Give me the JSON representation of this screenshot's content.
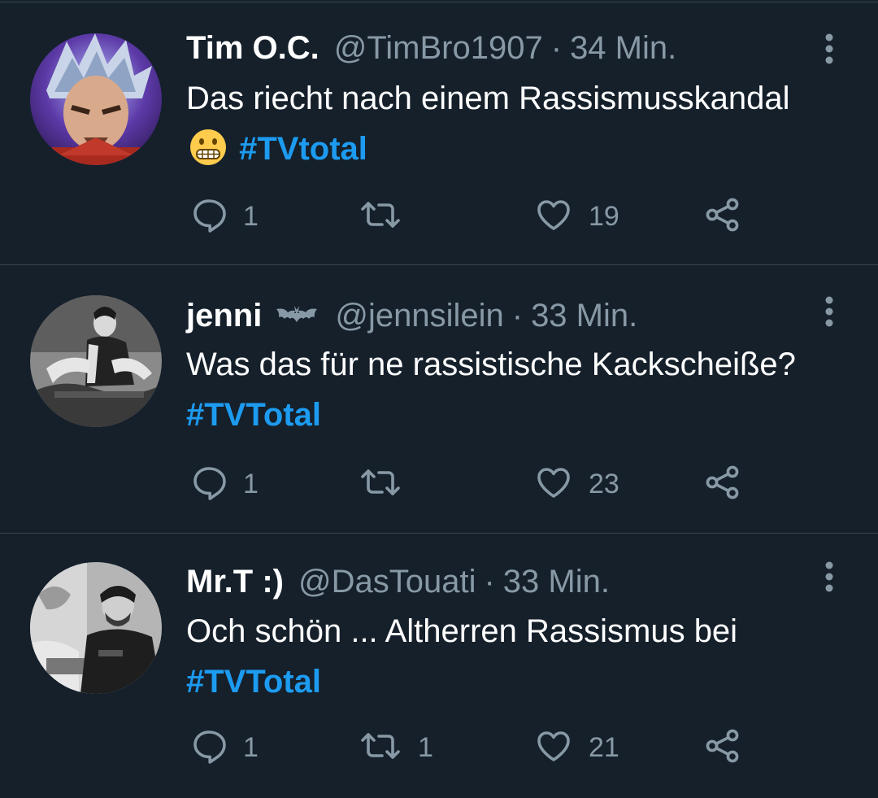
{
  "tweets": [
    {
      "author": "Tim O.C.",
      "handle": "@TimBro1907",
      "separator": "·",
      "time": "34 Min.",
      "text_before": "Das riecht nach einem Rassismusskandal",
      "emoji": "grimacing-face",
      "hashtag": "#TVtotal",
      "replies": "1",
      "retweets": "",
      "likes": "19"
    },
    {
      "author": "jenni",
      "badge": "bat-emoji",
      "handle": "@jennsilein",
      "separator": "·",
      "time": "33 Min.",
      "text_before": "Was das für ne rassistische Kackscheiße?",
      "hashtag": "#TVTotal",
      "replies": "1",
      "retweets": "",
      "likes": "23"
    },
    {
      "author": "Mr.T :)",
      "handle": "@DasTouati",
      "separator": "·",
      "time": "33 Min.",
      "text_before": "Och schön ... Altherren Rassismus bei",
      "hashtag": "#TVTotal",
      "replies": "1",
      "retweets": "1",
      "likes": "21"
    }
  ],
  "colors": {
    "background": "#15202b",
    "divider": "#38444d",
    "muted": "#8899a6",
    "hashtag": "#1d9bf0",
    "text": "#ffffff"
  },
  "icons": {
    "reply": "reply-bubble-icon",
    "retweet": "retweet-icon",
    "like": "heart-icon",
    "share": "share-icon",
    "more": "more-vertical-icon"
  }
}
